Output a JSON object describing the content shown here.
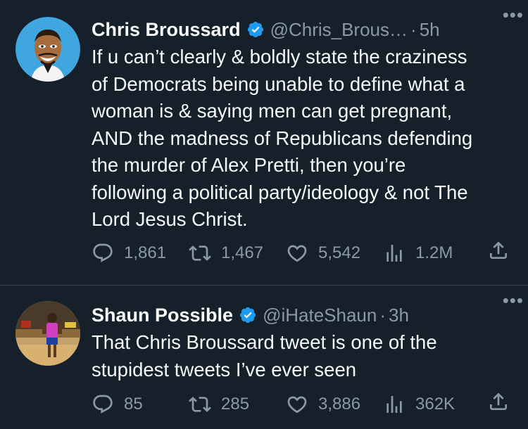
{
  "tweets": [
    {
      "name": "Chris Broussard",
      "handle": "@Chris_Brous…",
      "sep": "·",
      "time": "5h",
      "more": "•••",
      "lines": [
        "If u can’t clearly & boldly state the craziness",
        "of Democrats being unable to define what a",
        "woman is & saying men can get pregnant,",
        "AND the madness of Republicans defending",
        "the murder of Alex Pretti, then you’re",
        "following a political party/ideology & not The",
        "Lord Jesus Christ."
      ],
      "replies": "1,861",
      "retweets": "1,467",
      "likes": "5,542",
      "views": "1.2M"
    },
    {
      "name": "Shaun Possible",
      "handle": "@iHateShaun",
      "sep": "·",
      "time": "3h",
      "more": "•••",
      "lines": [
        "That Chris Broussard tweet is one of the",
        "stupidest tweets I’ve ever seen"
      ],
      "replies": "85",
      "retweets": "285",
      "likes": "3,886",
      "views": "362K"
    }
  ],
  "colors": {
    "background": "#15202b",
    "text": "#f7f9f9",
    "muted": "#8b98a5",
    "verified": "#1d9bf0",
    "divider": "#38444d"
  },
  "icons": [
    "reply-icon",
    "retweet-icon",
    "like-icon",
    "views-icon",
    "share-icon",
    "verified-badge-icon",
    "more-icon"
  ]
}
